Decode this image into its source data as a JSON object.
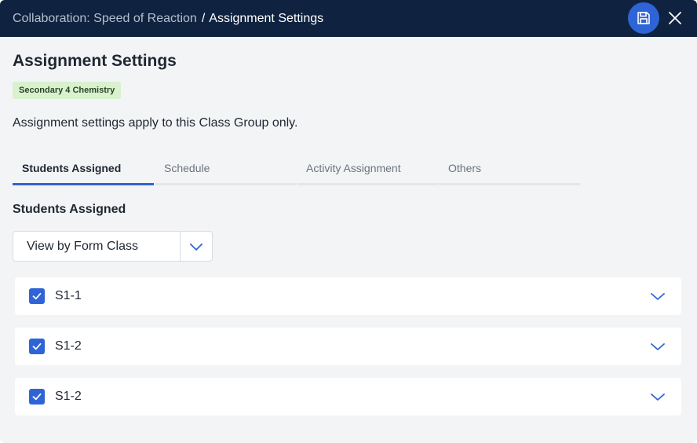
{
  "header": {
    "parent": "Collaboration: Speed of Reaction",
    "separator": "/",
    "current": "Assignment Settings",
    "save_icon": "save-icon",
    "close_icon": "close-icon"
  },
  "page": {
    "title": "Assignment Settings",
    "badge": "Secondary 4 Chemistry",
    "description": "Assignment settings apply to this Class Group only."
  },
  "tabs": [
    {
      "label": "Students Assigned",
      "active": true
    },
    {
      "label": "Schedule",
      "active": false
    },
    {
      "label": "Activity Assignment",
      "active": false
    },
    {
      "label": "Others",
      "active": false
    }
  ],
  "section": {
    "title": "Students Assigned",
    "view_select": {
      "value": "View by Form Class"
    }
  },
  "classes": [
    {
      "label": "S1-1",
      "checked": true
    },
    {
      "label": "S1-2",
      "checked": true
    },
    {
      "label": "S1-2",
      "checked": true
    }
  ],
  "colors": {
    "header_bg": "#0f2340",
    "accent": "#2f64d6",
    "badge_bg": "#d9f1cf",
    "page_bg": "#f3f4f6"
  }
}
